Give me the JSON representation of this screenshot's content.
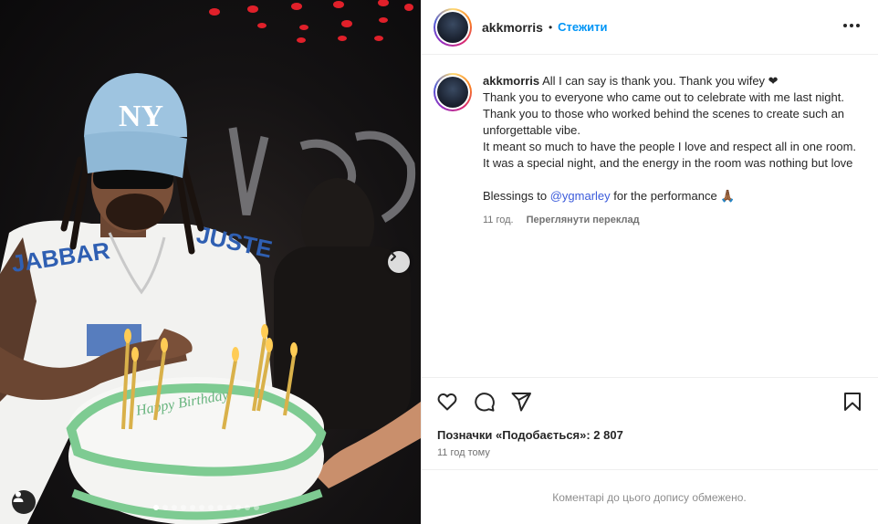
{
  "post": {
    "username": "akkmorris",
    "separator": "•",
    "follow_label": "Стежити",
    "caption": {
      "username": "akkmorris",
      "lines": [
        "All I can say is thank you. Thank you wifey ❤",
        "Thank you to everyone who came out to celebrate with me last night.",
        "Thank you to those who worked behind the scenes to create such an unforgettable vibe.",
        "It meant so much to have the people I love and respect all in one room. It was a special night, and the energy in the room was nothing but love"
      ],
      "blessings_prefix": "Blessings to ",
      "mention": "@ygmarley",
      "blessings_suffix": " for the performance 🙏🏾"
    },
    "caption_time": "11 год.",
    "translate_label": "Переглянути переклад",
    "likes_text": "Позначки «Подобається»: 2 807",
    "posted_time": "11 год тому",
    "comments_limited_text": "Коментарі до цього допису обмежено."
  },
  "photo": {
    "cap_logo": "NY",
    "jersey_text_left": "JABBAR",
    "jersey_text_right": "JUSTE",
    "cake_text": "Happy Birthday",
    "slide_count": 12,
    "active_slide": 0
  },
  "icons": {
    "like": "heart-outline-icon",
    "comment": "comment-bubble-icon",
    "share": "paper-plane-icon",
    "save": "bookmark-icon",
    "more": "ellipsis-icon",
    "next": "chevron-right-icon",
    "user_tag": "user-tag-icon"
  }
}
